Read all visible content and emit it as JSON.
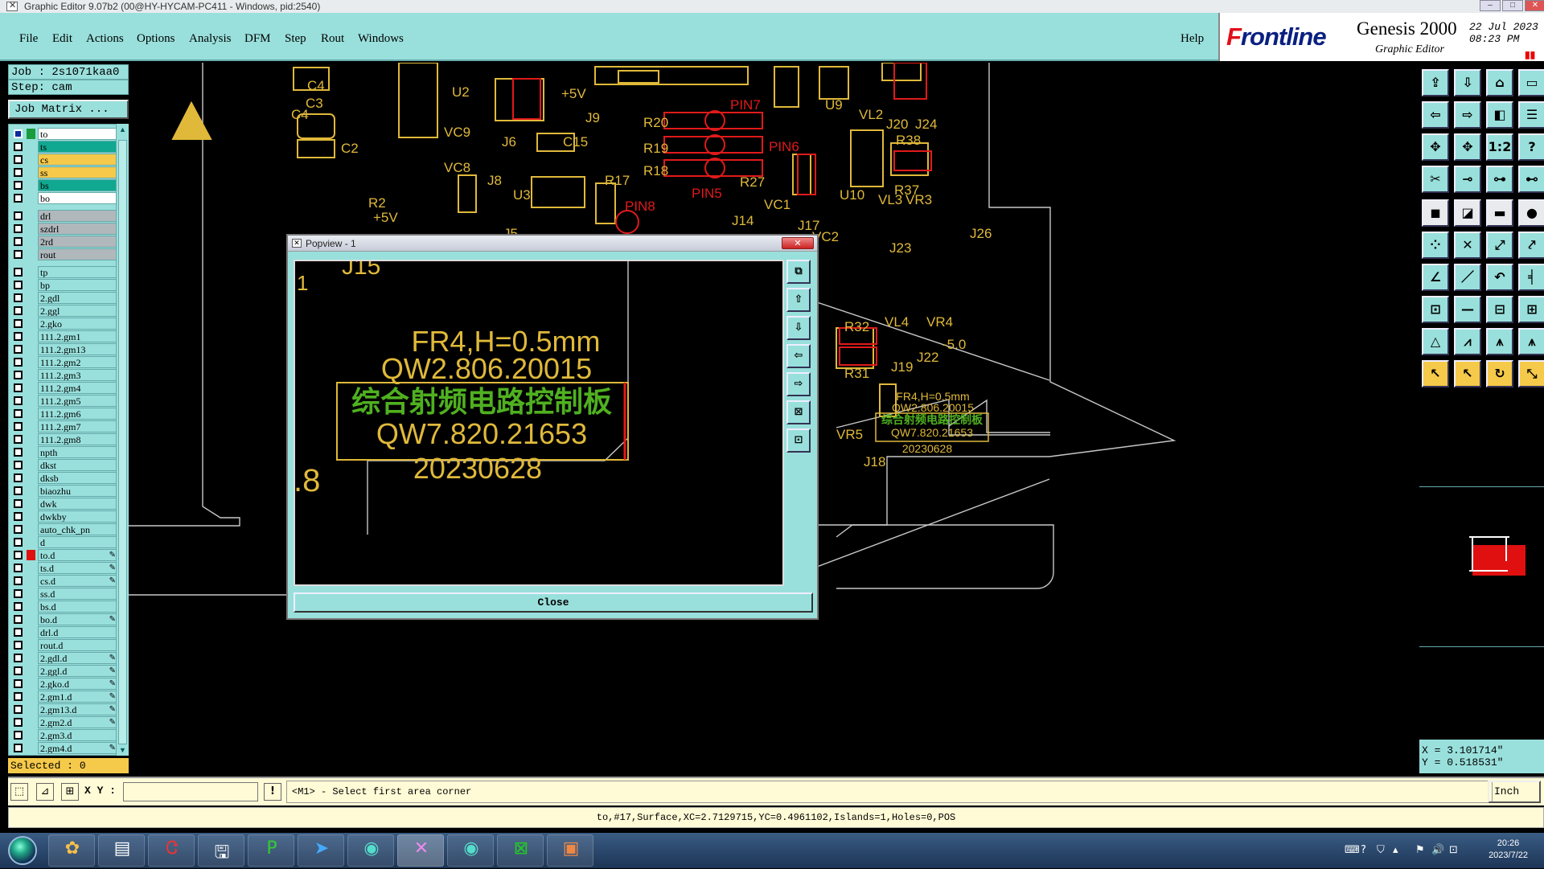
{
  "window": {
    "title": "Graphic Editor 9.07b2 (00@HY-HYCAM-PC411 - Windows, pid:2540)"
  },
  "menu": {
    "items": [
      "File",
      "Edit",
      "Actions",
      "Options",
      "Analysis",
      "DFM",
      "Step",
      "Rout",
      "Windows"
    ],
    "help": "Help"
  },
  "brand": {
    "logo_a": "F",
    "logo_b": "rontline",
    "product": "Genesis 2000",
    "subtitle": "Graphic Editor",
    "date": "22 Jul 2023",
    "time": "08:23 PM"
  },
  "job": {
    "job_label": "Job : 2s1071kaa0",
    "step_label": "Step: cam",
    "matrix_button": "Job Matrix ..."
  },
  "layers": [
    {
      "name": "to",
      "color": "#ffffff",
      "mark": "#1a9b3c",
      "selected": true,
      "edit": false
    },
    {
      "name": "ts",
      "color": "#10a890",
      "mark": "",
      "selected": false,
      "edit": false
    },
    {
      "name": "cs",
      "color": "#f5c94a",
      "mark": "",
      "selected": false,
      "edit": false
    },
    {
      "name": "ss",
      "color": "#f5c94a",
      "mark": "",
      "selected": false,
      "edit": false
    },
    {
      "name": "bs",
      "color": "#10a890",
      "mark": "",
      "selected": false,
      "edit": false
    },
    {
      "name": "bo",
      "color": "#ffffff",
      "mark": "",
      "selected": false,
      "edit": false
    },
    {
      "name": "drl",
      "color": "#b0b8bc",
      "mark": "",
      "selected": false,
      "edit": false
    },
    {
      "name": "szdrl",
      "color": "#b0b8bc",
      "mark": "",
      "selected": false,
      "edit": false
    },
    {
      "name": "2rd",
      "color": "#b0b8bc",
      "mark": "",
      "selected": false,
      "edit": false
    },
    {
      "name": "rout",
      "color": "#b0b8bc",
      "mark": "",
      "selected": false,
      "edit": false
    },
    {
      "name": "tp",
      "color": "#99e0dc",
      "mark": "",
      "selected": false,
      "edit": false
    },
    {
      "name": "bp",
      "color": "#99e0dc",
      "mark": "",
      "selected": false,
      "edit": false
    },
    {
      "name": "2.gdl",
      "color": "#99e0dc",
      "mark": "",
      "selected": false,
      "edit": false
    },
    {
      "name": "2.ggl",
      "color": "#99e0dc",
      "mark": "",
      "selected": false,
      "edit": false
    },
    {
      "name": "2.gko",
      "color": "#99e0dc",
      "mark": "",
      "selected": false,
      "edit": false
    },
    {
      "name": "111.2.gm1",
      "color": "#99e0dc",
      "mark": "",
      "selected": false,
      "edit": false
    },
    {
      "name": "111.2.gm13",
      "color": "#99e0dc",
      "mark": "",
      "selected": false,
      "edit": false
    },
    {
      "name": "111.2.gm2",
      "color": "#99e0dc",
      "mark": "",
      "selected": false,
      "edit": false
    },
    {
      "name": "111.2.gm3",
      "color": "#99e0dc",
      "mark": "",
      "selected": false,
      "edit": false
    },
    {
      "name": "111.2.gm4",
      "color": "#99e0dc",
      "mark": "",
      "selected": false,
      "edit": false
    },
    {
      "name": "111.2.gm5",
      "color": "#99e0dc",
      "mark": "",
      "selected": false,
      "edit": false
    },
    {
      "name": "111.2.gm6",
      "color": "#99e0dc",
      "mark": "",
      "selected": false,
      "edit": false
    },
    {
      "name": "111.2.gm7",
      "color": "#99e0dc",
      "mark": "",
      "selected": false,
      "edit": false
    },
    {
      "name": "111.2.gm8",
      "color": "#99e0dc",
      "mark": "",
      "selected": false,
      "edit": false
    },
    {
      "name": "npth",
      "color": "#99e0dc",
      "mark": "",
      "selected": false,
      "edit": false
    },
    {
      "name": "dkst",
      "color": "#99e0dc",
      "mark": "",
      "selected": false,
      "edit": false
    },
    {
      "name": "dksb",
      "color": "#99e0dc",
      "mark": "",
      "selected": false,
      "edit": false
    },
    {
      "name": "biaozhu",
      "color": "#99e0dc",
      "mark": "",
      "selected": false,
      "edit": false
    },
    {
      "name": "dwk",
      "color": "#99e0dc",
      "mark": "",
      "selected": false,
      "edit": false
    },
    {
      "name": "dwkby",
      "color": "#99e0dc",
      "mark": "",
      "selected": false,
      "edit": false
    },
    {
      "name": "auto_chk_pn",
      "color": "#99e0dc",
      "mark": "",
      "selected": false,
      "edit": false
    },
    {
      "name": "d",
      "color": "#99e0dc",
      "mark": "",
      "selected": false,
      "edit": false
    },
    {
      "name": "to.d",
      "color": "#99e0dc",
      "mark": "#e01010",
      "selected": false,
      "edit": true
    },
    {
      "name": "ts.d",
      "color": "#99e0dc",
      "mark": "",
      "selected": false,
      "edit": true
    },
    {
      "name": "cs.d",
      "color": "#99e0dc",
      "mark": "",
      "selected": false,
      "edit": true
    },
    {
      "name": "ss.d",
      "color": "#99e0dc",
      "mark": "",
      "selected": false,
      "edit": false
    },
    {
      "name": "bs.d",
      "color": "#99e0dc",
      "mark": "",
      "selected": false,
      "edit": false
    },
    {
      "name": "bo.d",
      "color": "#99e0dc",
      "mark": "",
      "selected": false,
      "edit": true
    },
    {
      "name": "drl.d",
      "color": "#99e0dc",
      "mark": "",
      "selected": false,
      "edit": false
    },
    {
      "name": "rout.d",
      "color": "#99e0dc",
      "mark": "",
      "selected": false,
      "edit": false
    },
    {
      "name": "2.gdl.d",
      "color": "#99e0dc",
      "mark": "",
      "selected": false,
      "edit": true
    },
    {
      "name": "2.ggl.d",
      "color": "#99e0dc",
      "mark": "",
      "selected": false,
      "edit": true
    },
    {
      "name": "2.gko.d",
      "color": "#99e0dc",
      "mark": "",
      "selected": false,
      "edit": true
    },
    {
      "name": "2.gm1.d",
      "color": "#99e0dc",
      "mark": "",
      "selected": false,
      "edit": true
    },
    {
      "name": "2.gm13.d",
      "color": "#99e0dc",
      "mark": "",
      "selected": false,
      "edit": true
    },
    {
      "name": "2.gm2.d",
      "color": "#99e0dc",
      "mark": "",
      "selected": false,
      "edit": true
    },
    {
      "name": "2.gm3.d",
      "color": "#99e0dc",
      "mark": "",
      "selected": false,
      "edit": false
    },
    {
      "name": "2.gm4.d",
      "color": "#99e0dc",
      "mark": "",
      "selected": false,
      "edit": true
    }
  ],
  "selected_label": "Selected : 0",
  "pcb_labels": [
    "U2",
    "+5V",
    "J9",
    "C4",
    "C3",
    "C2",
    "VC9",
    "J6",
    "C15",
    "R20",
    "R19",
    "R18",
    "PIN7",
    "PIN6",
    "PIN5",
    "PIN8",
    "U9",
    "VL2",
    "J20",
    "J24",
    "R38",
    "R37",
    "U10",
    "VC8",
    "J8",
    "U3",
    "R17",
    "R27",
    "VC1",
    "VL3",
    "VR3",
    "+5V",
    "R2",
    "J5",
    "J14",
    "J17",
    "VC2",
    "J23",
    "J26",
    "R32",
    "R31",
    "VL4",
    "VR4",
    "J19",
    "J22",
    "-5.0",
    "J18",
    "VR5",
    "C4"
  ],
  "board_label": {
    "line1": "FR4,H=0.5mm",
    "line2": "QW2.806.20015",
    "line3": "综合射频电路控制板",
    "line4": "QW7.820.21653",
    "line5": "20230628"
  },
  "popview": {
    "title": "Popview - 1",
    "close_label": "Close",
    "top_label": "J15",
    "pin_label": "1",
    "dot_label": ".8"
  },
  "coords": {
    "x": "X = 3.101714\"",
    "y": "Y = 0.518531\""
  },
  "command": {
    "xy_label": "X Y :",
    "input_value": "",
    "message": "<M1> - Select first area corner",
    "unit": "Inch"
  },
  "status": {
    "text": "to,#17,Surface,XC=2.7129715,YC=0.4961102,Islands=1,Holes=0,POS"
  },
  "taskbar": {
    "time": "20:26",
    "date": "2023/7/22"
  },
  "colors": {
    "panel": "#99e0dc",
    "silk": "#e0b93a",
    "copper": "#e01a1a",
    "green_text": "#4fb020",
    "outline": "#c8c8c8"
  }
}
